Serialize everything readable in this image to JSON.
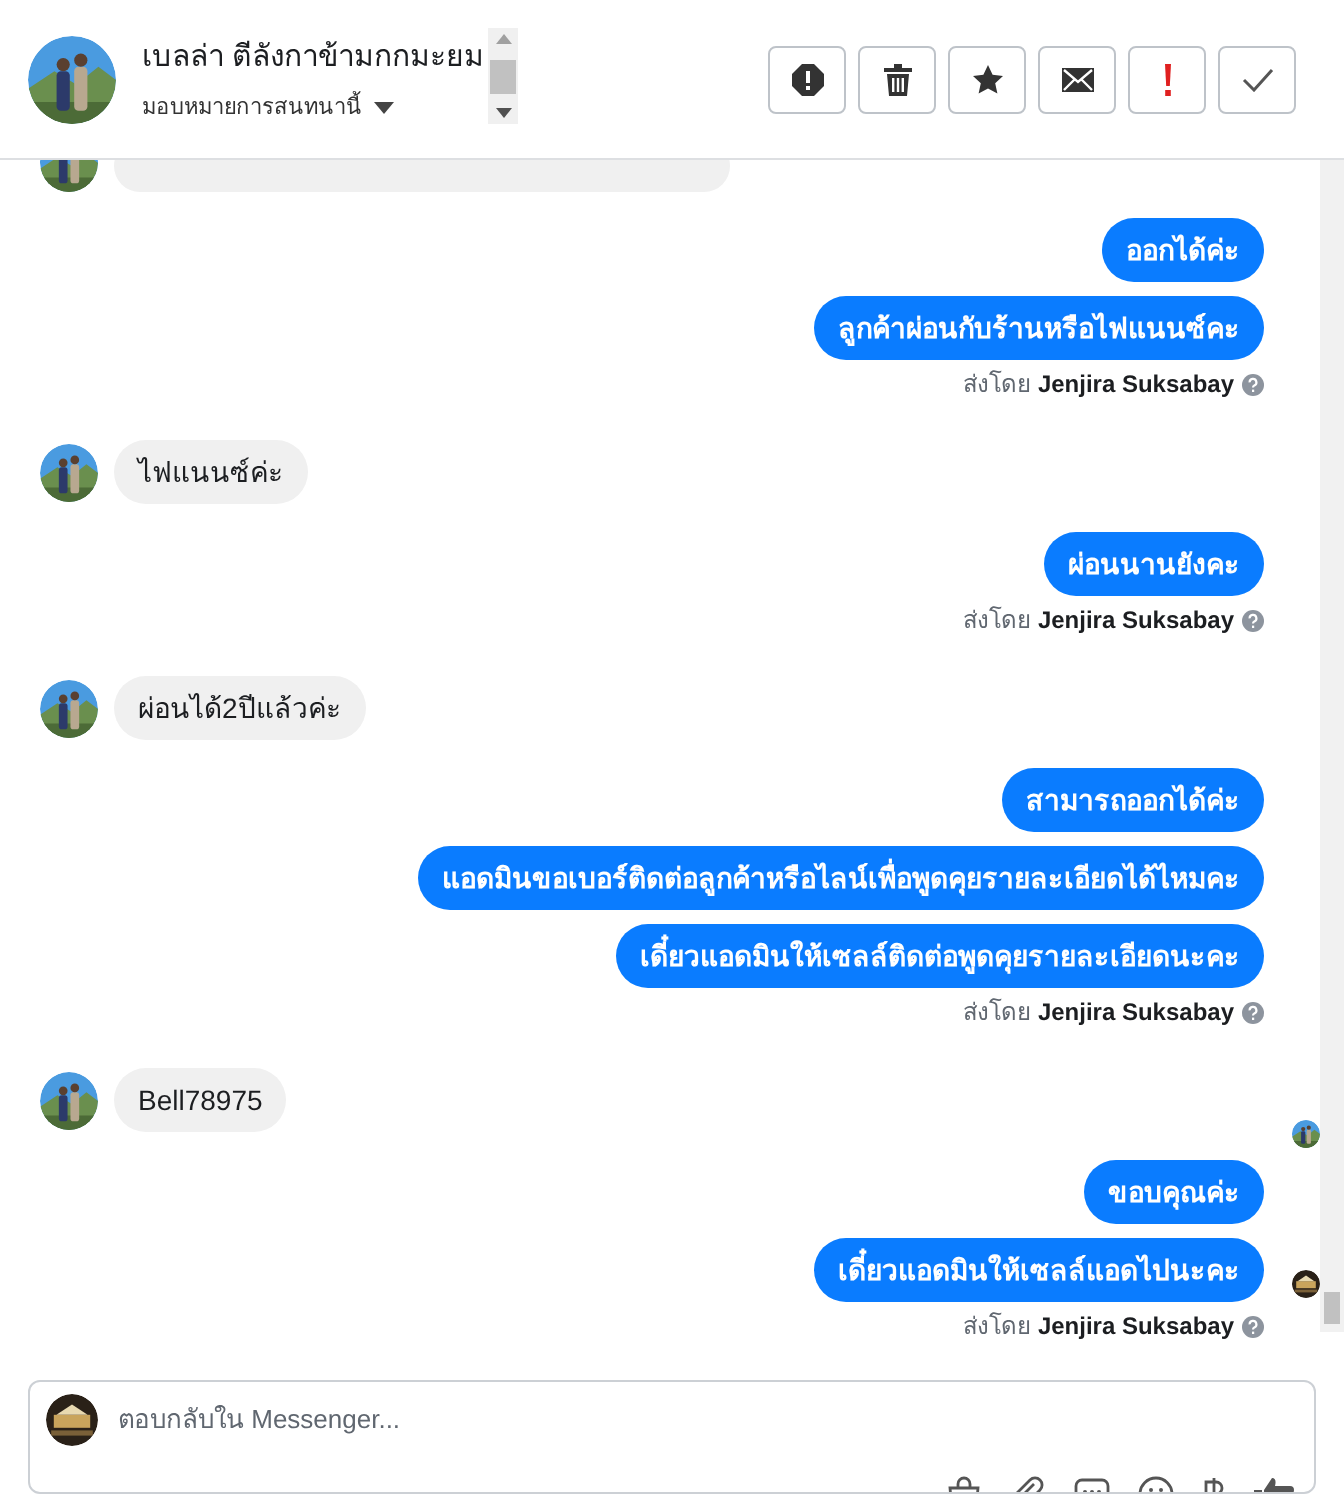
{
  "header": {
    "name": "เบลล่า ตีลังกาข้ามกกมะยม",
    "assign_label": "มอบหมายการสนทนานี้",
    "buttons": [
      {
        "kind": "spam"
      },
      {
        "kind": "delete"
      },
      {
        "kind": "star"
      },
      {
        "kind": "mail"
      },
      {
        "kind": "important"
      },
      {
        "kind": "done"
      }
    ]
  },
  "messages": [
    {
      "kind": "out",
      "text": "ออกได้ค่ะ"
    },
    {
      "kind": "out",
      "text": "ลูกค้าผ่อนกับร้านหรือไฟแนนซ์คะ"
    },
    {
      "kind": "note",
      "prefix": "ส่งโดย",
      "name": "Jenjira Suksabay"
    },
    {
      "kind": "in",
      "text": "ไฟแนนซ์ค่ะ",
      "read_marker": false
    },
    {
      "kind": "out",
      "text": "ผ่อนนานยังคะ"
    },
    {
      "kind": "note",
      "prefix": "ส่งโดย",
      "name": "Jenjira Suksabay"
    },
    {
      "kind": "in",
      "text": "ผ่อนได้2ปีแล้วค่ะ",
      "read_marker": false
    },
    {
      "kind": "out",
      "text": "สามารถออกได้ค่ะ"
    },
    {
      "kind": "out",
      "text": "แอดมินขอเบอร์ติดต่อลูกค้าหรือไลน์เพื่อพูดคุยรายละเอียดได้ไหมคะ"
    },
    {
      "kind": "out",
      "text": "เดี๋ยวแอดมินให้เซลล์ติดต่อพูดคุยรายละเอียดนะคะ"
    },
    {
      "kind": "note",
      "prefix": "ส่งโดย",
      "name": "Jenjira Suksabay"
    },
    {
      "kind": "in",
      "text": "Bell78975",
      "read_marker": true
    },
    {
      "kind": "out",
      "text": "ขอบคุณค่ะ"
    },
    {
      "kind": "out",
      "text": "เดี๋ยวแอดมินให้เซลล์แอดไปนะคะ",
      "read_marker": true
    },
    {
      "kind": "note",
      "prefix": "ส่งโดย",
      "name": "Jenjira Suksabay"
    }
  ],
  "composer": {
    "placeholder": "ตอบกลับใน Messenger...",
    "tools": [
      {
        "kind": "bag"
      },
      {
        "kind": "clip"
      },
      {
        "kind": "chat"
      },
      {
        "kind": "smile"
      },
      {
        "kind": "baht"
      },
      {
        "kind": "like"
      }
    ]
  }
}
